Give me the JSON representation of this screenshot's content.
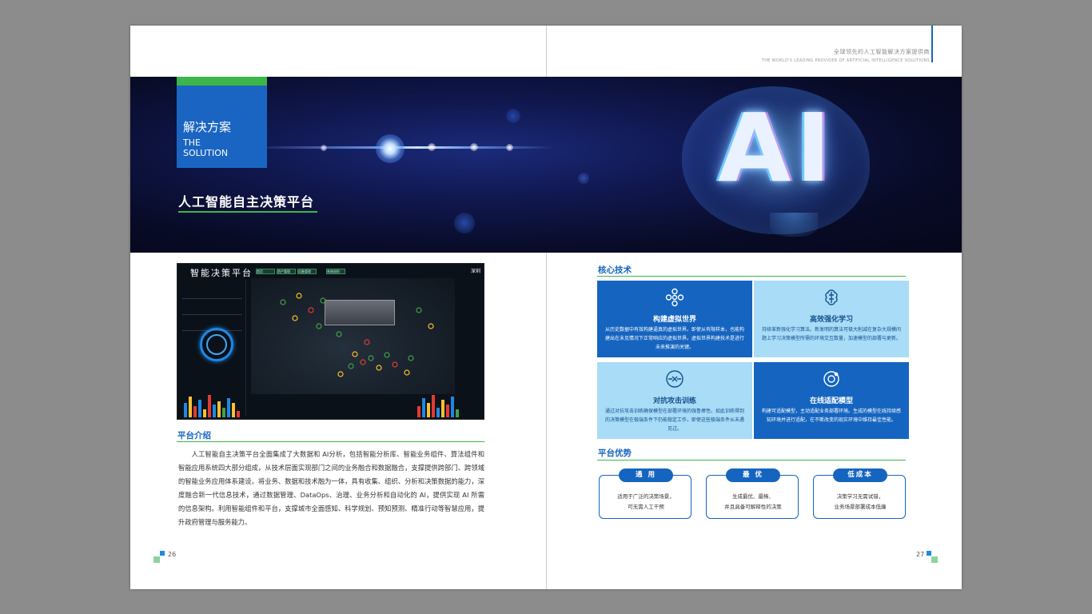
{
  "header": {
    "tagline_cn": "全球领先的人工智能解决方案提供商",
    "tagline_en": "THE WORLD'S LEADING PROVIDER OF ARTIFICIAL INTELLIGENCE SOLUTIONS"
  },
  "banner": {
    "label_cn": "解决方案",
    "label_en_1": "THE",
    "label_en_2": "SOLUTION",
    "title": "人工智能自主决策平台",
    "ai_text": "AI"
  },
  "dashboard": {
    "title": "智能决策平台",
    "nav": [
      "首页",
      "资产管理",
      "设备管理",
      "系统巡检"
    ],
    "city": "深圳"
  },
  "left_page": {
    "section_title": "平台介绍",
    "intro": "人工智能自主决策平台全面集成了大数据和 AI分析，包括智能分析库、智能业务组件、算法组件和智能应用系统四大部分组成，从技术层面实现部门之间的业务融合和数据融合，支撑提供跨部门、跨领域的智能业务应用体系建设。将业务、数据和技术融为一体，具有收集、组织、分析和决策数据的能力，深度融合新一代信息技术，通过数据管理、DataOps、治理、业务分析和自动化的 AI，提供实现 AI 所需的信息架构。利用智能组件和平台，支撑城市全面感知、科学规划、预知预测、精准行动等智慧应用，提升政府管理与服务能力。",
    "page_number": "26"
  },
  "right_page": {
    "core_title": "核心技术",
    "cards": [
      {
        "icon": "network-icon",
        "title": "构建虚拟世界",
        "desc": "从历史数据中有效构建逼真的虚拟世界。即使从有限样本，也能构建出在未见情况下正常响应的虚拟世界。虚拟世界构建技术是进行未来推演的关键。"
      },
      {
        "icon": "brain-icon",
        "title": "高效强化学习",
        "desc": "持续革新强化学习算法。新发明的算法可极大削减在复杂大规模问题上学习决策模型所需的环境交互数量，加速模型的部署与更新。"
      },
      {
        "icon": "shield-arrows-icon",
        "title": "对抗攻击训练",
        "desc": "通过对抗攻击训练确保模型在部署环境的强鲁棒性。如此训练得到的决策模型在极端条件下仍能稳定工作，即使这些极端条件从未遇见过。"
      },
      {
        "icon": "refresh-cycle-icon",
        "title": "在线适配模型",
        "desc": "构建可适配模型，主动适配业务部署环境。生成的模型在线持续感知环境并进行适配，在不断改变的现实环境中维持最佳性能。"
      }
    ],
    "advantage_title": "平台优势",
    "advantages": [
      {
        "label": "通 用",
        "line1": "适用于广泛的决策场景，",
        "line2": "可无需人工干预"
      },
      {
        "label": "最 优",
        "line1": "生成最优、最稀、",
        "line2": "并且具备可解释性的决策"
      },
      {
        "label": "低成本",
        "line1": "决策学习无需试错，",
        "line2": "业务场景部署成本低廉"
      }
    ],
    "page_number": "27"
  },
  "colors": {
    "brand_blue": "#1565c0",
    "accent_green": "#3cb54a",
    "light_blue": "#a9dcf6"
  }
}
